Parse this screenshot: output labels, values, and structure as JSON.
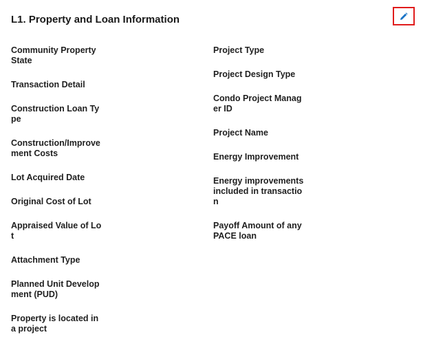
{
  "section": {
    "title": "L1. Property and Loan Information",
    "edit_icon": "pencil-icon",
    "accent_color": "#1a73c6",
    "highlight_color": "#e01b1b"
  },
  "left_fields": [
    "Community Property State",
    "Transaction Detail",
    "Construction Loan Type",
    "Construction/Improvement Costs",
    "Lot Acquired Date",
    "Original Cost of Lot",
    "Appraised Value of Lot",
    "Attachment Type",
    "Planned Unit Development (PUD)",
    "Property is located in a project"
  ],
  "right_fields": [
    "Project Type",
    "Project Design Type",
    "Condo Project Manager ID",
    "Project Name",
    "Energy Improvement",
    "Energy improvements included in transaction",
    "Payoff Amount of any PACE loan"
  ]
}
